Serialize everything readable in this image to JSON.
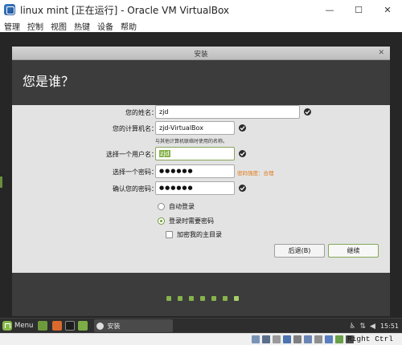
{
  "host_window": {
    "title": "linux mint [正在运行] - Oracle VM VirtualBox",
    "controls": {
      "minimize": "—",
      "maximize": "☐",
      "close": "✕"
    },
    "menu": [
      "管理",
      "控制",
      "视图",
      "热键",
      "设备",
      "帮助"
    ]
  },
  "installer": {
    "window_title": "安装",
    "heading": "您是谁？",
    "form": {
      "name_label": "您的姓名：",
      "name_value": "zjd",
      "computer_label": "您的计算机名：",
      "computer_value": "zjd-VirtualBox",
      "computer_hint": "与其他计算机联络时使用的名称。",
      "username_label": "选择一个用户名：",
      "username_value": "zjd",
      "password_label": "选择一个密码：",
      "password_value": "●●●●●●",
      "password_strength": "密码强度：合理",
      "confirm_label": "确认您的密码：",
      "confirm_value": "●●●●●●"
    },
    "options": {
      "auto_login": "自动登录",
      "require_password": "登录时需要密码",
      "encrypt_home": "加密我的主目录"
    },
    "buttons": {
      "back": "后退(B)",
      "continue": "继续"
    },
    "progress": {
      "total_steps": 7,
      "current_step": 7
    }
  },
  "taskbar": {
    "menu_label": "Menu",
    "task_label": "安装",
    "clock": "15:51"
  },
  "host_status": {
    "host_key": "Right Ctrl"
  },
  "colors": {
    "mint_accent": "#87b34c",
    "strength_text": "#e07b1a",
    "installer_header": "#3c3c3c",
    "form_background": "#e3e3e3"
  }
}
